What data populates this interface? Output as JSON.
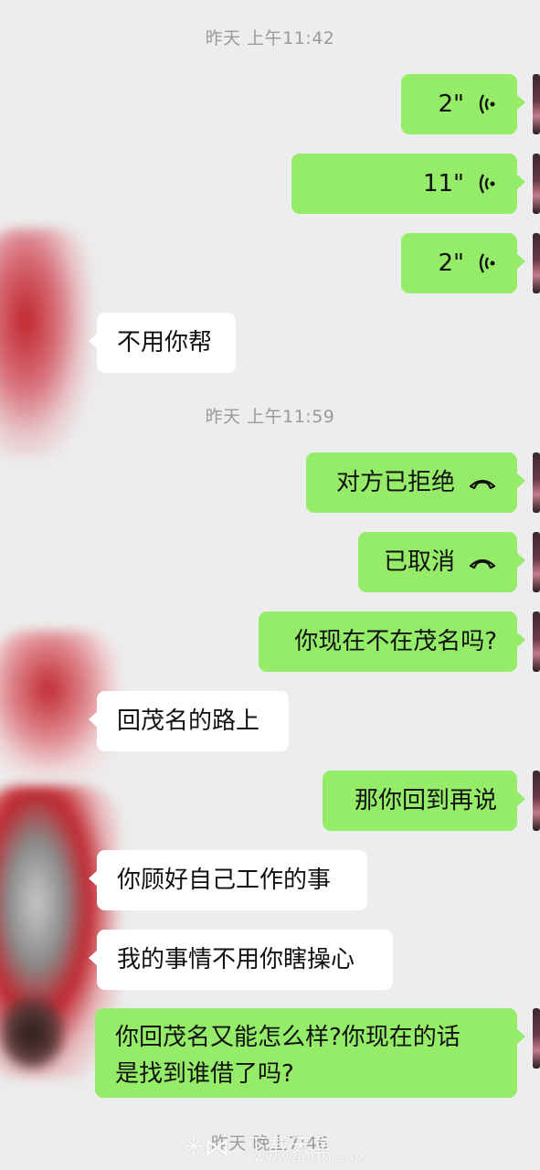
{
  "timestamps": {
    "t1": "昨天 上午11:42",
    "t2": "昨天 上午11:59",
    "t3": "昨天 晚上7:46"
  },
  "messages": {
    "voice1": "2\"",
    "voice2": "11\"",
    "voice3": "2\"",
    "m1": "不用你帮",
    "call_rejected": "对方已拒绝",
    "call_cancelled": "已取消",
    "m2": "你现在不在茂名吗?",
    "m3": "回茂名的路上",
    "m4": "那你回到再说",
    "m5": "你顾好自己工作的事",
    "m6": "我的事情不用你瞎操心",
    "m7_line1": "你回茂名又能怎么样?你现在的话",
    "m7_line2": "是找到谁借了吗?"
  },
  "icons": {
    "voice": "voice-wave-icon",
    "call": "phone-hangup-icon"
  },
  "watermark": {
    "name": "下载天堂",
    "url": "WWW.GDMM.COM"
  },
  "colors": {
    "background": "#ededed",
    "outgoing_bubble": "#95ec69",
    "incoming_bubble": "#ffffff",
    "timestamp": "#9a9a9a"
  }
}
